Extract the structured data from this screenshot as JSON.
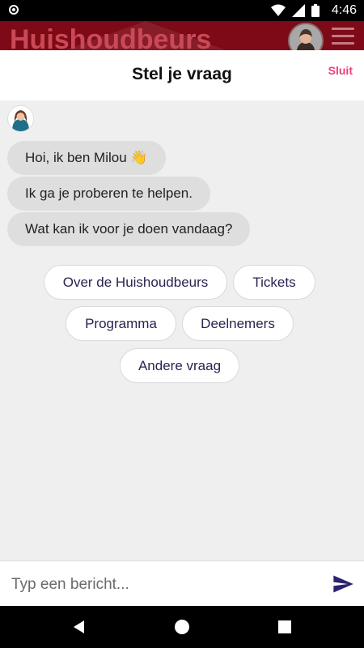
{
  "status_bar": {
    "time": "4:46"
  },
  "app_bar": {
    "brand": "Huishoudbeurs"
  },
  "header": {
    "title": "Stel je vraag",
    "close_label": "Sluit"
  },
  "chat": {
    "messages": [
      "Hoi, ik ben Milou 👋",
      "Ik ga je proberen te helpen.",
      "Wat kan ik voor je doen vandaag?"
    ],
    "choices": [
      "Over de Huishoudbeurs",
      "Tickets",
      "Programma",
      "Deelnemers",
      "Andere vraag"
    ]
  },
  "composer": {
    "placeholder": "Typ een bericht..."
  },
  "colors": {
    "brand": "#7d0a16",
    "accent": "#ef3f79",
    "send": "#2a2370"
  },
  "icons": [
    "wifi-icon",
    "signal-icon",
    "battery-icon",
    "menu-icon",
    "send-icon",
    "back-icon",
    "home-icon",
    "recents-icon"
  ]
}
